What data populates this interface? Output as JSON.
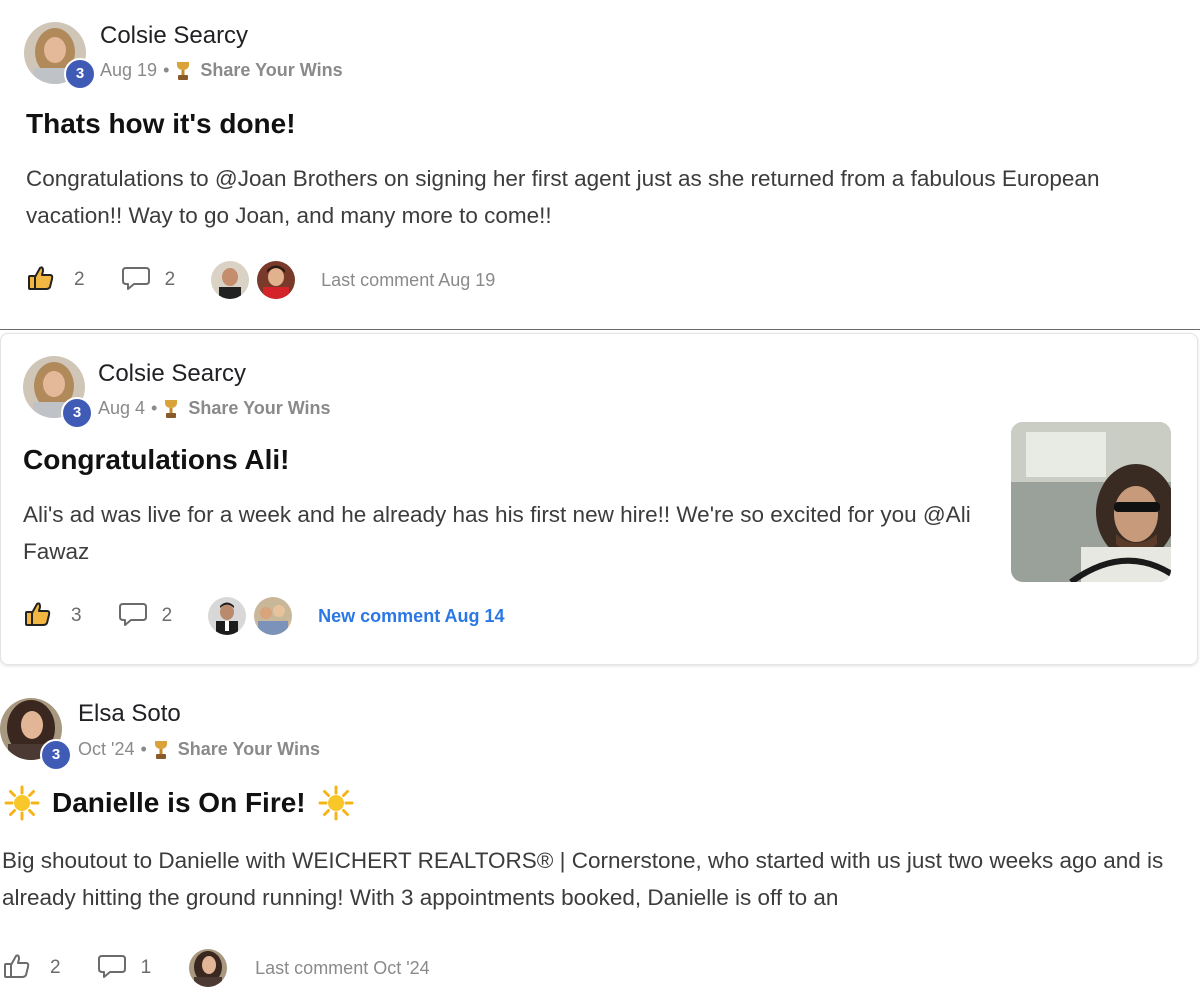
{
  "posts": [
    {
      "author": "Colsie Searcy",
      "level": "3",
      "date": "Aug 19",
      "category": "Share Your Wins",
      "title": "Thats how it's done!",
      "body": "Congratulations to @Joan Brothers on signing her first agent just as she returned from a fabulous European vacation!! Way to go Joan, and many more to come!!",
      "likes": "2",
      "comments": "2",
      "last_comment": "Last comment Aug 19"
    },
    {
      "author": "Colsie Searcy",
      "level": "3",
      "date": "Aug 4",
      "category": "Share Your Wins",
      "title": "Congratulations Ali!",
      "body": "Ali's ad was live for a week and he already has his first new hire!! We're so excited for you @Ali Fawaz",
      "likes": "3",
      "comments": "2",
      "new_comment": "New comment Aug 14"
    },
    {
      "author": "Elsa Soto",
      "level": "3",
      "date": "Oct '24",
      "category": "Share Your Wins",
      "title": "Danielle is On Fire!",
      "body": "Big shoutout to Danielle with WEICHERT REALTORS® | Cornerstone, who started with us just two weeks ago and is already hitting the ground running! With 3 appointments booked, Danielle is off to an",
      "likes": "2",
      "comments": "1",
      "last_comment": "Last comment Oct '24"
    }
  ],
  "colors": {
    "badge": "#3f5bb5",
    "new_comment": "#2b78e4",
    "meta": "#8a8a8a"
  },
  "icons": [
    "thumbs-up-icon",
    "comment-bubble-icon",
    "trophy-icon",
    "sun-emoji-icon"
  ]
}
